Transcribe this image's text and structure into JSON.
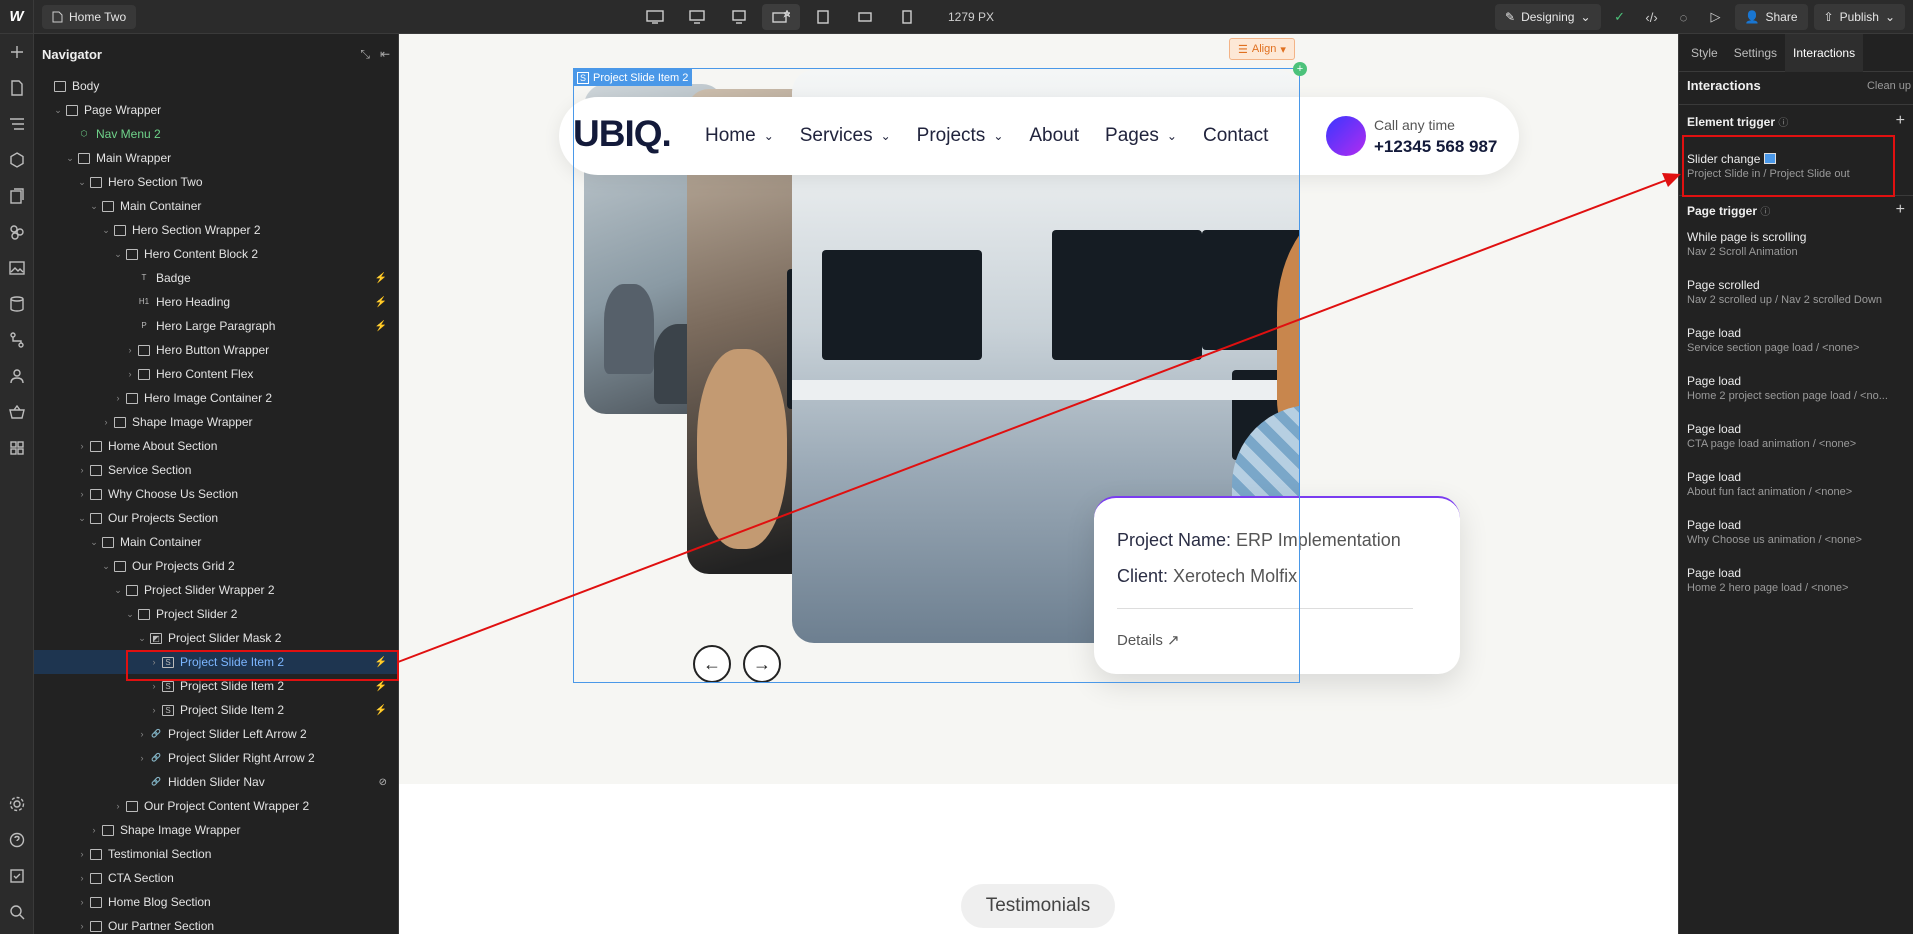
{
  "topbar": {
    "page_name": "Home Two",
    "width_label": "1279 PX",
    "mode": "Designing",
    "share": "Share",
    "publish": "Publish"
  },
  "navigator": {
    "title": "Navigator",
    "items": [
      {
        "label": "Body",
        "depth": 0,
        "icon": "box",
        "caret": ""
      },
      {
        "label": "Page Wrapper",
        "depth": 1,
        "icon": "box",
        "caret": "v"
      },
      {
        "label": "Nav Menu 2",
        "depth": 2,
        "icon": "component",
        "caret": "",
        "style": "green"
      },
      {
        "label": "Main Wrapper",
        "depth": 2,
        "icon": "box",
        "caret": "v"
      },
      {
        "label": "Hero Section  Two",
        "depth": 3,
        "icon": "section",
        "caret": "v"
      },
      {
        "label": "Main Container",
        "depth": 4,
        "icon": "container",
        "caret": "v"
      },
      {
        "label": "Hero Section Wrapper 2",
        "depth": 5,
        "icon": "box",
        "caret": "v"
      },
      {
        "label": "Hero Content Block 2",
        "depth": 6,
        "icon": "box",
        "caret": "v"
      },
      {
        "label": "Badge",
        "depth": 7,
        "icon": "T",
        "caret": "",
        "flag": "⚡"
      },
      {
        "label": "Hero Heading",
        "depth": 7,
        "icon": "H1",
        "caret": "",
        "flag": "⚡"
      },
      {
        "label": "Hero Large Paragraph",
        "depth": 7,
        "icon": "P",
        "caret": "",
        "flag": "⚡"
      },
      {
        "label": "Hero Button Wrapper",
        "depth": 7,
        "icon": "box",
        "caret": ">"
      },
      {
        "label": "Hero Content Flex",
        "depth": 7,
        "icon": "box",
        "caret": ">"
      },
      {
        "label": "Hero Image Container 2",
        "depth": 6,
        "icon": "box",
        "caret": ">"
      },
      {
        "label": "Shape Image Wrapper",
        "depth": 5,
        "icon": "box",
        "caret": ">"
      },
      {
        "label": "Home About Section",
        "depth": 3,
        "icon": "section",
        "caret": ">"
      },
      {
        "label": "Service Section",
        "depth": 3,
        "icon": "section",
        "caret": ">"
      },
      {
        "label": "Why Choose Us Section",
        "depth": 3,
        "icon": "section",
        "caret": ">"
      },
      {
        "label": "Our Projects Section",
        "depth": 3,
        "icon": "section",
        "caret": "v"
      },
      {
        "label": "Main Container",
        "depth": 4,
        "icon": "container",
        "caret": "v"
      },
      {
        "label": "Our Projects Grid 2",
        "depth": 5,
        "icon": "box",
        "caret": "v"
      },
      {
        "label": "Project Slider Wrapper 2",
        "depth": 6,
        "icon": "box",
        "caret": "v"
      },
      {
        "label": "Project Slider 2",
        "depth": 7,
        "icon": "slider",
        "caret": "v"
      },
      {
        "label": "Project Slider Mask 2",
        "depth": 8,
        "icon": "mask",
        "caret": "v"
      },
      {
        "label": "Project Slide Item 2",
        "depth": 9,
        "icon": "S",
        "caret": ">",
        "flag": "⚡",
        "style": "selected"
      },
      {
        "label": "Project Slide Item 2",
        "depth": 9,
        "icon": "S",
        "caret": ">",
        "flag": "⚡"
      },
      {
        "label": "Project Slide Item 2",
        "depth": 9,
        "icon": "S",
        "caret": ">",
        "flag": "⚡"
      },
      {
        "label": "Project Slider Left Arrow 2",
        "depth": 8,
        "icon": "link",
        "caret": ">"
      },
      {
        "label": "Project Slider Right Arrow 2",
        "depth": 8,
        "icon": "link",
        "caret": ">"
      },
      {
        "label": "Hidden Slider Nav",
        "depth": 8,
        "icon": "link",
        "caret": "",
        "flag": "⊘"
      },
      {
        "label": "Our Project Content Wrapper 2",
        "depth": 6,
        "icon": "box",
        "caret": ">"
      },
      {
        "label": "Shape Image Wrapper",
        "depth": 4,
        "icon": "box",
        "caret": ">"
      },
      {
        "label": "Testimonial Section",
        "depth": 3,
        "icon": "section",
        "caret": ">"
      },
      {
        "label": "CTA Section",
        "depth": 3,
        "icon": "section",
        "caret": ">"
      },
      {
        "label": "Home Blog Section",
        "depth": 3,
        "icon": "section",
        "caret": ">"
      },
      {
        "label": "Our Partner Section",
        "depth": 3,
        "icon": "section",
        "caret": ">"
      }
    ]
  },
  "canvas": {
    "selected_tag": "Project Slide Item 2",
    "align_label": "Align",
    "brand": "UBIQ.",
    "nav_links": [
      "Home",
      "Services",
      "Projects",
      "About",
      "Pages",
      "Contact"
    ],
    "call_small": "Call any time",
    "call_number": "+12345 568 987",
    "project_name_label": "Project Name:",
    "project_name_value": " ERP Implementation",
    "client_label": "Client:",
    "client_value": " Xerotech Molfix",
    "details": "Details",
    "testimonials": "Testimonials"
  },
  "panel": {
    "tabs": [
      "Style",
      "Settings",
      "Interactions"
    ],
    "heading": "Interactions",
    "clean_up": "Clean up",
    "element_trigger": "Element trigger",
    "slider_change": "Slider change",
    "slider_change_sub": "Project Slide in / Project Slide out",
    "page_trigger": "Page trigger",
    "page_items": [
      {
        "title": "While page is scrolling",
        "sub": "Nav 2 Scroll Animation"
      },
      {
        "title": "Page scrolled",
        "sub": "Nav 2 scrolled up / Nav 2 scrolled Down"
      },
      {
        "title": "Page load",
        "sub": "Service section page load / <none>"
      },
      {
        "title": "Page load",
        "sub": "Home 2 project section page load / <no..."
      },
      {
        "title": "Page load",
        "sub": "CTA page load animation / <none>"
      },
      {
        "title": "Page load",
        "sub": "About fun fact animation / <none>"
      },
      {
        "title": "Page load",
        "sub": "Why Choose us animation / <none>"
      },
      {
        "title": "Page load",
        "sub": "Home 2 hero page load / <none>"
      }
    ]
  },
  "colors": {
    "accent_blue": "#4a98e8",
    "annotation_red": "#e01010",
    "nav_green": "#6fd38a"
  }
}
